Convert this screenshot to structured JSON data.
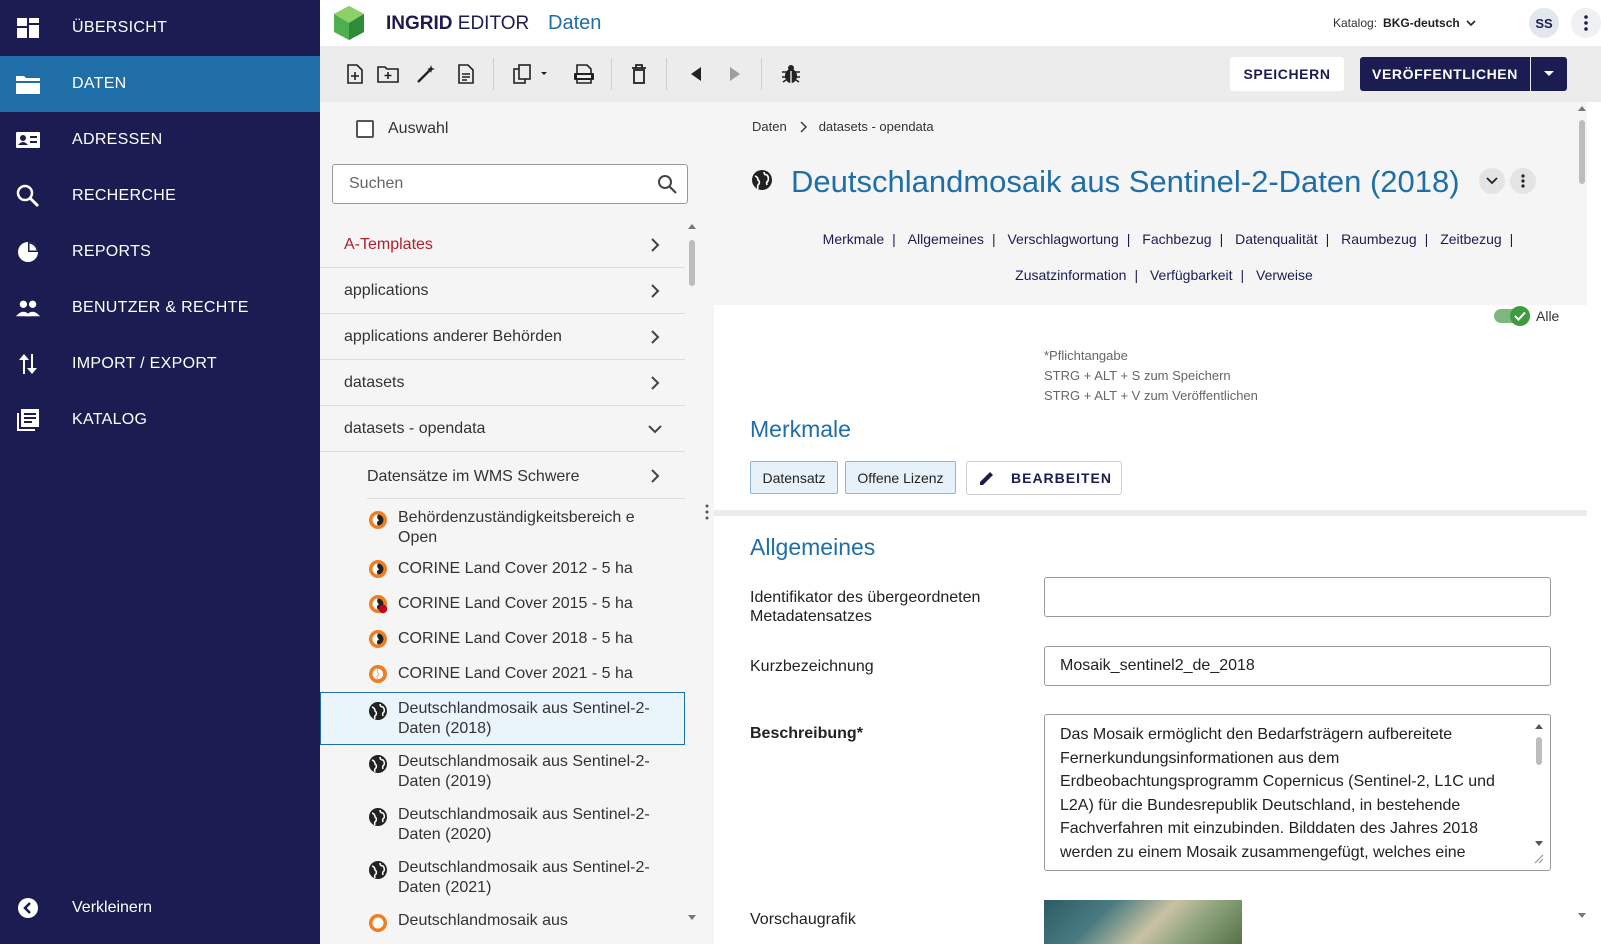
{
  "nav": {
    "items": [
      {
        "label": "ÜBERSICHT",
        "icon": "dashboard-icon"
      },
      {
        "label": "DATEN",
        "icon": "folder-icon",
        "active": true
      },
      {
        "label": "ADRESSEN",
        "icon": "contact-card-icon"
      },
      {
        "label": "RECHERCHE",
        "icon": "search-icon"
      },
      {
        "label": "REPORTS",
        "icon": "pie-chart-icon"
      },
      {
        "label": "BENUTZER & RECHTE",
        "icon": "users-icon"
      },
      {
        "label": "IMPORT / EXPORT",
        "icon": "import-export-icon"
      },
      {
        "label": "KATALOG",
        "icon": "catalog-icon"
      }
    ],
    "collapse_label": "Verkleinern"
  },
  "header": {
    "brand_bold": "INGRID",
    "brand_rest": " EDITOR",
    "section": "Daten",
    "catalog_label": "Katalog:",
    "catalog_value": "BKG-deutsch",
    "user_initials": "SS"
  },
  "toolbar": {
    "save_label": "SPEICHERN",
    "publish_label": "VERÖFFENTLICHEN"
  },
  "tree": {
    "select_all_label": "Auswahl",
    "search_placeholder": "Suchen",
    "folders": [
      {
        "label": "A-Templates",
        "color": "#b0202e"
      },
      {
        "label": "applications"
      },
      {
        "label": "applications anderer Behörden"
      },
      {
        "label": "datasets"
      },
      {
        "label": "datasets - opendata",
        "expanded": true
      }
    ],
    "subfolder": {
      "label": "Datensätze im WMS Schwere"
    },
    "documents": [
      {
        "label": "Behördenzuständigkeitsbereich e Open",
        "icon": "opendata-globe-icon"
      },
      {
        "label": "CORINE Land Cover 2012 - 5 ha",
        "icon": "opendata-globe-icon"
      },
      {
        "label": "CORINE Land Cover 2015 - 5 ha",
        "icon": "opendata-globe-warning-icon"
      },
      {
        "label": "CORINE Land Cover 2018 - 5 ha",
        "icon": "opendata-globe-icon"
      },
      {
        "label": "CORINE Land Cover 2021 - 5 ha",
        "icon": "opendata-globe-icon"
      },
      {
        "label": "Deutschlandmosaik aus Sentinel-2-Daten (2018)",
        "icon": "globe-icon",
        "selected": true
      },
      {
        "label": "Deutschlandmosaik aus Sentinel-2-Daten (2019)",
        "icon": "globe-icon"
      },
      {
        "label": "Deutschlandmosaik aus Sentinel-2-Daten (2020)",
        "icon": "globe-icon"
      },
      {
        "label": "Deutschlandmosaik aus Sentinel-2-Daten (2021)",
        "icon": "globe-icon"
      },
      {
        "label": "Deutschlandmosaik aus",
        "icon": "opendata-globe-icon"
      }
    ]
  },
  "form": {
    "breadcrumb": [
      "Daten",
      "datasets - opendata"
    ],
    "title": "Deutschlandmosaik aus Sentinel-2-Daten (2018)",
    "sections_row1": [
      "Merkmale",
      "Allgemeines",
      "Verschlagwortung",
      "Fachbezug",
      "Datenqualität",
      "Raumbezug",
      "Zeitbezug"
    ],
    "sections_row2": [
      "Zusatzinformation",
      "Verfügbarkeit",
      "Verweise"
    ],
    "toggle_label": "Alle",
    "hints": [
      "*Pflichtangabe",
      "STRG + ALT + S zum Speichern",
      "STRG + ALT + V zum Veröffentlichen"
    ],
    "merkmale": {
      "title": "Merkmale",
      "chips": [
        "Datensatz",
        "Offene Lizenz"
      ],
      "edit_label": "BEARBEITEN"
    },
    "allgemeines": {
      "title": "Allgemeines",
      "parent_id_label": "Identifikator des übergeordneten Metadatensatzes",
      "parent_id_value": "",
      "short_name_label": "Kurzbezeichnung",
      "short_name_value": "Mosaik_sentinel2_de_2018",
      "description_label": "Beschreibung*",
      "description_value": "Das Mosaik ermöglicht den Bedarfsträgern aufbereitete Fernerkundungsinformationen aus dem Erdbeobachtungsprogramm Copernicus (Sentinel-2, L1C und L2A) für die Bundesrepublik Deutschland, in bestehende Fachverfahren mit einzubinden. Bilddaten des Jahres 2018 werden zu einem Mosaik zusammengefügt, welches eine",
      "preview_label": "Vorschaugrafik"
    }
  }
}
